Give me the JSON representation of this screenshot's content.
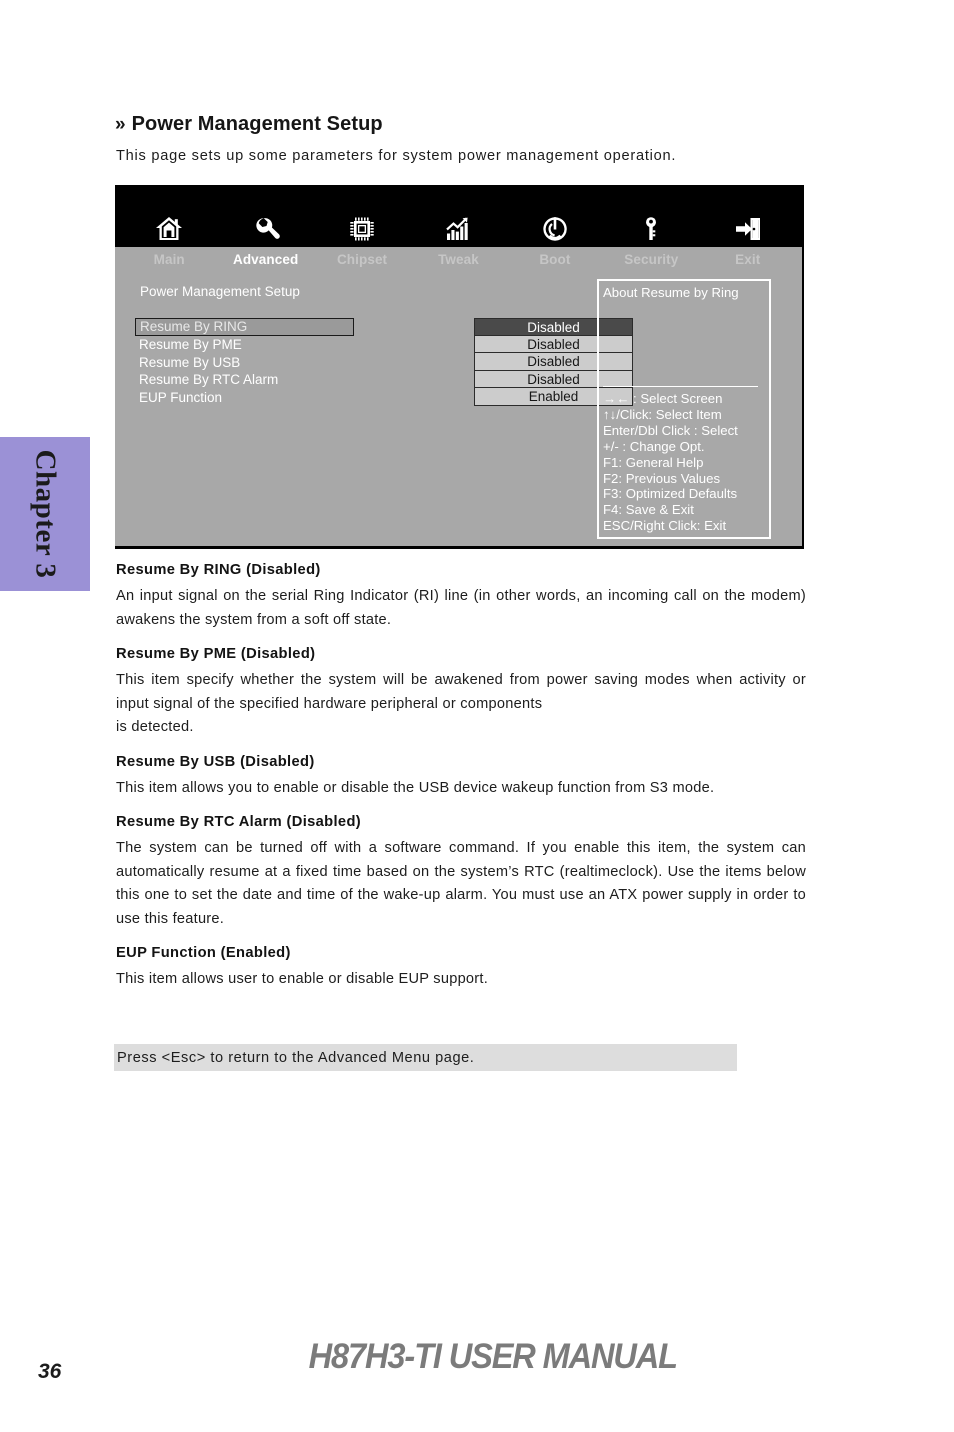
{
  "heading": {
    "chevron": "»",
    "title": "Power Management Setup",
    "intro": "This page sets up some parameters for system power management operation."
  },
  "bios": {
    "tabs": [
      {
        "label": "Main",
        "icon": "home-icon",
        "state": "dim"
      },
      {
        "label": "Advanced",
        "icon": "wrench-icon",
        "state": "active"
      },
      {
        "label": "Chipset",
        "icon": "chip-icon",
        "state": "dim"
      },
      {
        "label": "Tweak",
        "icon": "bar-chart-icon",
        "state": "dim"
      },
      {
        "label": "Boot",
        "icon": "power-icon",
        "state": "dim"
      },
      {
        "label": "Security",
        "icon": "key-icon",
        "state": "dim"
      },
      {
        "label": "Exit",
        "icon": "exit-icon",
        "state": "dim"
      }
    ],
    "section_title": "Power Management Setup",
    "items": [
      {
        "label": "Resume By RING",
        "value": "Disabled",
        "selected": true
      },
      {
        "label": "Resume By  PME",
        "value": "Disabled",
        "selected": false
      },
      {
        "label": "Resume By USB",
        "value": "Disabled",
        "selected": false
      },
      {
        "label": "Resume By RTC Alarm",
        "value": "Disabled",
        "selected": false
      },
      {
        "label": "EUP Function",
        "value": "Enabled",
        "selected": false
      }
    ],
    "help": {
      "title": "About  Resume by Ring",
      "keys": [
        "→←   : Select Screen",
        "↑↓/Click: Select Item",
        "Enter/Dbl Click : Select",
        "+/- : Change Opt.",
        "F1: General Help",
        "F2: Previous Values",
        "F3: Optimized Defaults",
        "F4: Save & Exit",
        "ESC/Right Click: Exit"
      ]
    }
  },
  "sections": [
    {
      "head": "Resume By RING (Disabled)",
      "body": "An input signal on the serial Ring Indicator (RI) line (in other words, an incoming call on the modem) awakens the system from a soft off state."
    },
    {
      "head": "Resume By PME (Disabled)",
      "body": "This item specify whether the system will be awakened from power saving modes when activity or input signal of the specified hardware peripheral or components",
      "body2": "is detected."
    },
    {
      "head": "Resume By USB (Disabled)",
      "body": "This item allows you to enable or disable the USB device wakeup function from S3 mode."
    },
    {
      "head": "Resume By RTC Alarm (Disabled)",
      "body": "The system can be turned off with a software command. If you enable this item, the system can automatically resume at a fixed time based on the system’s RTC (realtimeclock). Use the items below this one to set the date and time of the wake-up alarm. You must use an ATX power supply in order to use this feature."
    },
    {
      "head": "EUP Function (Enabled)",
      "body": "This item allows user to enable or disable EUP support."
    }
  ],
  "esc_note": "Press <Esc> to return to the Advanced Menu page.",
  "chapter_tab": "Chapter 3",
  "footer": {
    "manual_title": "H87H3-TI USER MANUAL",
    "page_number": "36"
  },
  "colors": {
    "chapter_tab_purple": "#9b91d6",
    "bios_background": "#a8a8a8",
    "bios_topbar": "#000000",
    "value_box": "#cccccc",
    "value_box_selected": "#4a4a4a",
    "esc_bar": "#dddddd",
    "footer_title": "#7b7b7b"
  }
}
